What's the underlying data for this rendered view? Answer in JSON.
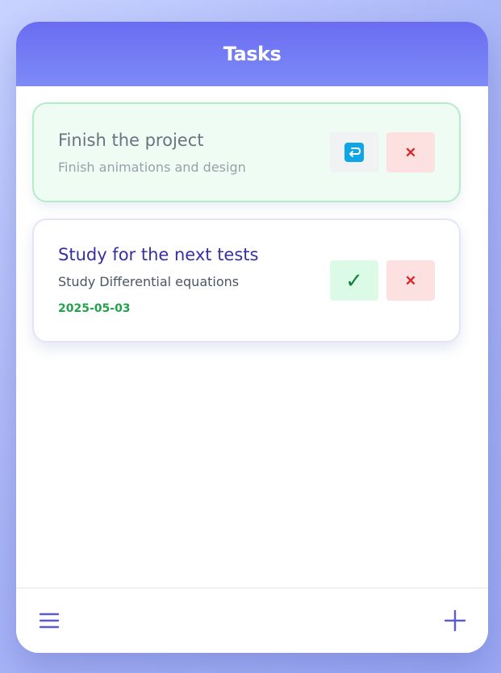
{
  "header": {
    "title": "Tasks"
  },
  "tasks": [
    {
      "title": "Finish the project",
      "description": "Finish animations and design",
      "status": "completed",
      "actions": [
        "undo-icon",
        "delete-icon"
      ]
    },
    {
      "title": "Study for the next tests",
      "description": "Study Differential equations",
      "date": "2025-05-03",
      "status": "pending",
      "actions": [
        "check-icon",
        "delete-icon"
      ]
    }
  ],
  "footer": {
    "left_icon": "menu-icon",
    "right_icon": "plus-icon"
  },
  "colors": {
    "accent": "#6366f1",
    "header_gradient_start": "#6a6cf2",
    "header_gradient_end": "#7d8bf7",
    "completed_bg": "#effcf3",
    "date_green": "#22a34b",
    "delete_red": "#dc2626"
  },
  "glyphs": {
    "delete": "✕",
    "complete": "✓"
  }
}
